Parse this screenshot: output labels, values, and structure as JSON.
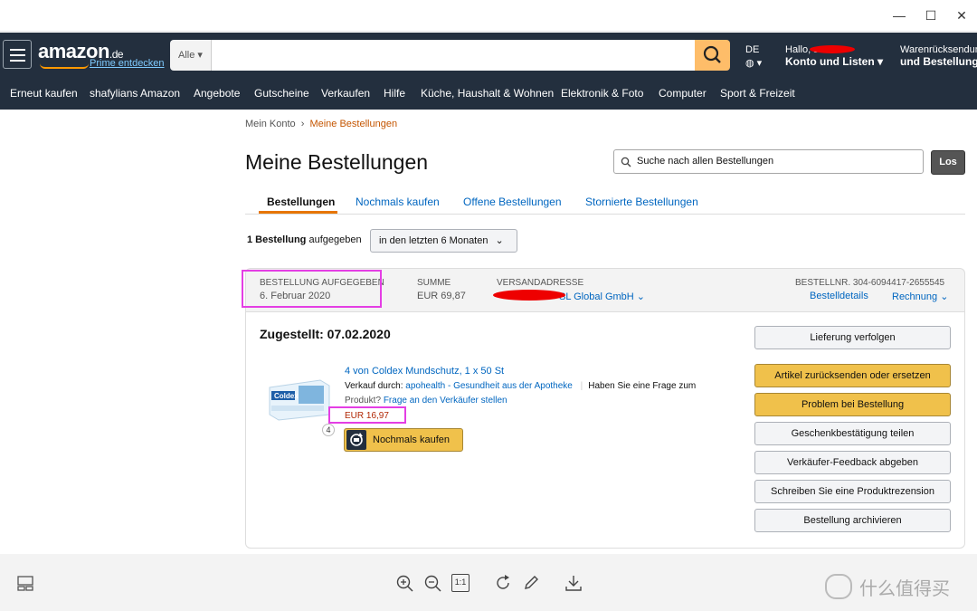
{
  "window": {
    "minimize": "—",
    "maximize": "☐",
    "close": "✕"
  },
  "header": {
    "logo": "amazon",
    "logo_tld": ".de",
    "prime": "Prime entdecken",
    "search_category": "Alle",
    "lang": "DE",
    "hello": "Hallo, s",
    "account": "Konto und Listen",
    "returns_line1": "Warenrücksendung",
    "returns_line2": "und Bestellung"
  },
  "subnav": [
    "Erneut kaufen",
    "shafylians Amazon",
    "Angebote",
    "Gutscheine",
    "Verkaufen",
    "Hilfe",
    "Küche, Haushalt & Wohnen",
    "Elektronik & Foto",
    "Computer",
    "Sport & Freizeit"
  ],
  "breadcrumb": {
    "root": "Mein Konto",
    "sep": "›",
    "current": "Meine Bestellungen"
  },
  "title": "Meine Bestellungen",
  "order_search": {
    "placeholder": "Suche nach allen Bestellungen",
    "button": "Los"
  },
  "tabs": [
    "Bestellungen",
    "Nochmals kaufen",
    "Offene Bestellungen",
    "Stornierte Bestellungen"
  ],
  "summary": {
    "count_bold": "1 Bestellung",
    "count_rest": " aufgegeben",
    "period": "in den letzten 6 Monaten"
  },
  "order": {
    "placed_label": "BESTELLUNG AUFGEGEBEN",
    "placed_value": "6. Februar 2020",
    "sum_label": "SUMME",
    "sum_value": "EUR 69,87",
    "address_label": "VERSANDADRESSE",
    "address_value": "SL Global GmbH ⌄",
    "number_label": "BESTELLNR. 304-6094417-2655545",
    "details_link": "Bestelldetails",
    "invoice_link": "Rechnung ⌄",
    "delivered": "Zugestellt: 07.02.2020",
    "product_title": "4 von Coldex Mundschutz, 1 x 50 St",
    "seller_prefix": "Verkauf durch: ",
    "seller_name": "apohealth - Gesundheit aus der Apotheke",
    "question_1": "Haben Sie eine Frage zum",
    "question_2": "Produkt? ",
    "question_link": "Frage an den Verkäufer stellen",
    "price": "EUR 16,97",
    "qty": "4",
    "rebuy": "Nochmals kaufen",
    "product_image_text": "Coldex"
  },
  "side_buttons": [
    "Lieferung verfolgen",
    "Artikel zurücksenden oder ersetzen",
    "Problem bei Bestellung",
    "Geschenkbestätigung teilen",
    "Verkäufer-Feedback abgeben",
    "Schreiben Sie eine Produktrezension",
    "Bestellung archivieren"
  ],
  "viewer": {
    "fit_label": "1:1"
  },
  "watermark": "什么值得买",
  "colors": {
    "accent": "#e77600",
    "link": "#0066c0",
    "header": "#232f3e",
    "highlight": "#e43ee4",
    "button_yellow": "#f0c14b"
  }
}
